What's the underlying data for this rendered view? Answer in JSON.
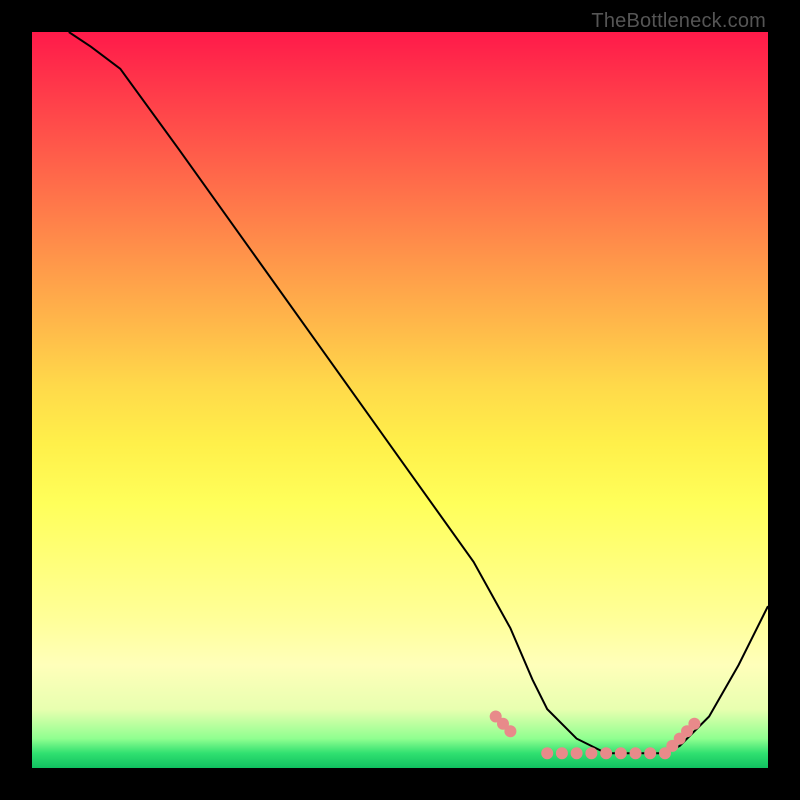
{
  "watermark": "TheBottleneck.com",
  "chart_data": {
    "type": "line",
    "title": "",
    "xlabel": "",
    "ylabel": "",
    "xlim": [
      0,
      100
    ],
    "ylim": [
      0,
      100
    ],
    "grid": false,
    "legend": false,
    "background_gradient": {
      "direction": "vertical",
      "stops": [
        {
          "pos": 0.0,
          "color": "#ff1a4a"
        },
        {
          "pos": 0.5,
          "color": "#ffe04a"
        },
        {
          "pos": 0.9,
          "color": "#ffffba"
        },
        {
          "pos": 1.0,
          "color": "#10c060"
        }
      ]
    },
    "series": [
      {
        "name": "curve",
        "color": "#000000",
        "x": [
          5,
          8,
          12,
          20,
          30,
          40,
          50,
          60,
          65,
          68,
          70,
          74,
          78,
          82,
          86,
          88,
          92,
          96,
          100
        ],
        "y": [
          100,
          98,
          95,
          84,
          70,
          56,
          42,
          28,
          19,
          12,
          8,
          4,
          2,
          2,
          2,
          3,
          7,
          14,
          22
        ]
      }
    ],
    "markers": [
      {
        "name": "dots",
        "color": "#e88a8a",
        "size": 6,
        "points": [
          {
            "x": 63,
            "y": 7
          },
          {
            "x": 64,
            "y": 6
          },
          {
            "x": 65,
            "y": 5
          },
          {
            "x": 70,
            "y": 2
          },
          {
            "x": 72,
            "y": 2
          },
          {
            "x": 74,
            "y": 2
          },
          {
            "x": 76,
            "y": 2
          },
          {
            "x": 78,
            "y": 2
          },
          {
            "x": 80,
            "y": 2
          },
          {
            "x": 82,
            "y": 2
          },
          {
            "x": 84,
            "y": 2
          },
          {
            "x": 86,
            "y": 2
          },
          {
            "x": 87,
            "y": 3
          },
          {
            "x": 88,
            "y": 4
          },
          {
            "x": 89,
            "y": 5
          },
          {
            "x": 90,
            "y": 6
          }
        ]
      }
    ]
  }
}
